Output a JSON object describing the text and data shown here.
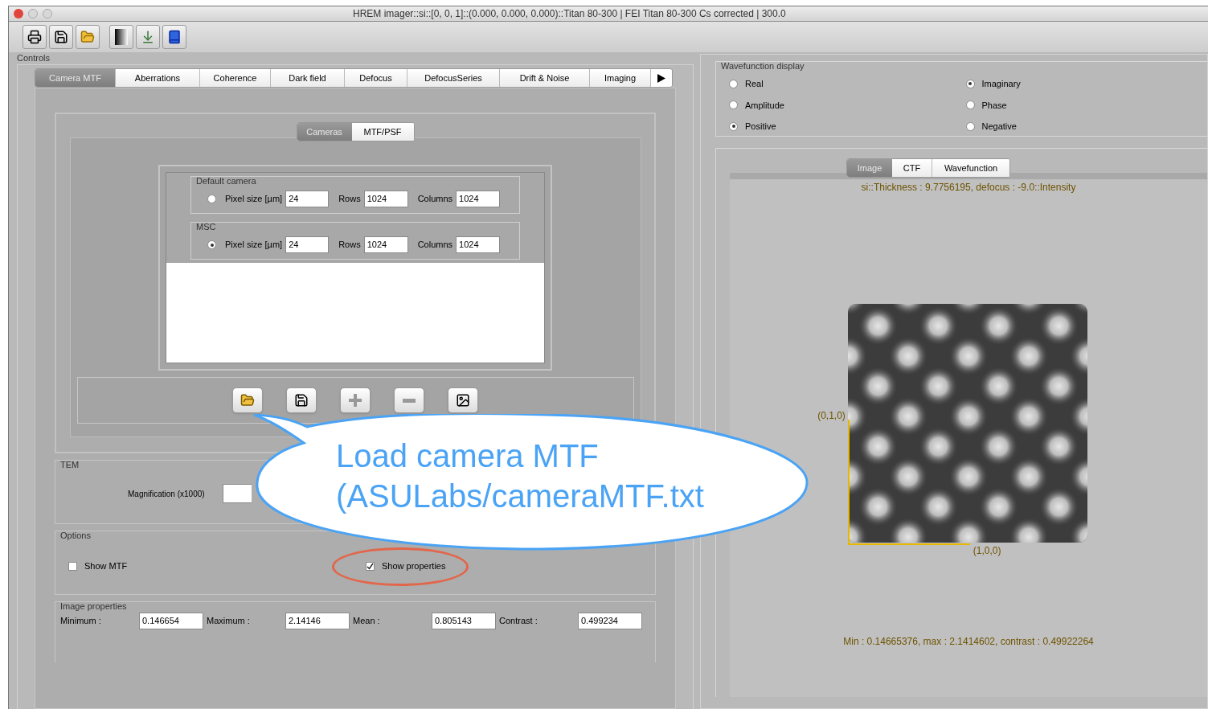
{
  "window": {
    "title": "HREM imager::si::[0, 0, 1]::(0.000, 0.000, 0.000)::Titan 80-300 | FEI Titan 80-300 Cs corrected | 300.0"
  },
  "controls": {
    "title": "Controls",
    "tabs": [
      {
        "label": "Camera MTF",
        "selected": true
      },
      {
        "label": "Aberrations",
        "selected": false
      },
      {
        "label": "Coherence",
        "selected": false
      },
      {
        "label": "Dark field",
        "selected": false
      },
      {
        "label": "Defocus",
        "selected": false
      },
      {
        "label": "DefocusSeries",
        "selected": false
      },
      {
        "label": "Drift & Noise",
        "selected": false
      },
      {
        "label": "Imaging",
        "selected": false
      }
    ],
    "subtabs": [
      {
        "label": "Cameras",
        "selected": true
      },
      {
        "label": "MTF/PSF",
        "selected": false
      }
    ],
    "cameras": [
      {
        "title": "Default camera",
        "selected": false,
        "pixel_label": "Pixel size [µm]",
        "pixel_value": "24",
        "rows_label": "Rows",
        "rows_value": "1024",
        "columns_label": "Columns",
        "columns_value": "1024"
      },
      {
        "title": "MSC",
        "selected": true,
        "pixel_label": "Pixel size [µm]",
        "pixel_value": "24",
        "rows_label": "Rows",
        "rows_value": "1024",
        "columns_label": "Columns",
        "columns_value": "1024"
      }
    ],
    "tem": {
      "title": "TEM",
      "magnification_label": "Magnification (x1000)"
    },
    "options": {
      "title": "Options",
      "checkboxes": [
        {
          "label": "Show MTF",
          "checked": false,
          "circled": false
        },
        {
          "label": "Show properties",
          "checked": true,
          "circled": true
        }
      ]
    },
    "image_properties": {
      "title": "Image properties",
      "fields": [
        {
          "label": "Minimum :",
          "value": "0.146654"
        },
        {
          "label": "Maximum :",
          "value": "2.14146"
        },
        {
          "label": "Mean :",
          "value": "0.805143"
        },
        {
          "label": "Contrast :",
          "value": "0.499234"
        }
      ]
    }
  },
  "wavefunction_display": {
    "title": "Wavefunction display",
    "options": [
      {
        "label": "Real",
        "selected": false
      },
      {
        "label": "Imaginary",
        "selected": true
      },
      {
        "label": "Amplitude",
        "selected": false
      },
      {
        "label": "Phase",
        "selected": false
      },
      {
        "label": "Positive",
        "selected": true
      },
      {
        "label": "Negative",
        "selected": false
      }
    ]
  },
  "view": {
    "tabs": [
      {
        "label": "Image",
        "selected": true
      },
      {
        "label": "CTF",
        "selected": false
      },
      {
        "label": "Wavefunction",
        "selected": false
      }
    ],
    "header": "si::Thickness : 9.7756195, defocus : -9.0::Intensity",
    "y_axis_label": "(0,1,0)",
    "x_axis_label": "(1,0,0)",
    "footer": "Min : 0.14665376, max : 2.1414602, contrast : 0.49922264"
  },
  "callout": {
    "lines": [
      "Load camera MTF",
      "(ASULabs/cameraMTF.txt"
    ]
  }
}
